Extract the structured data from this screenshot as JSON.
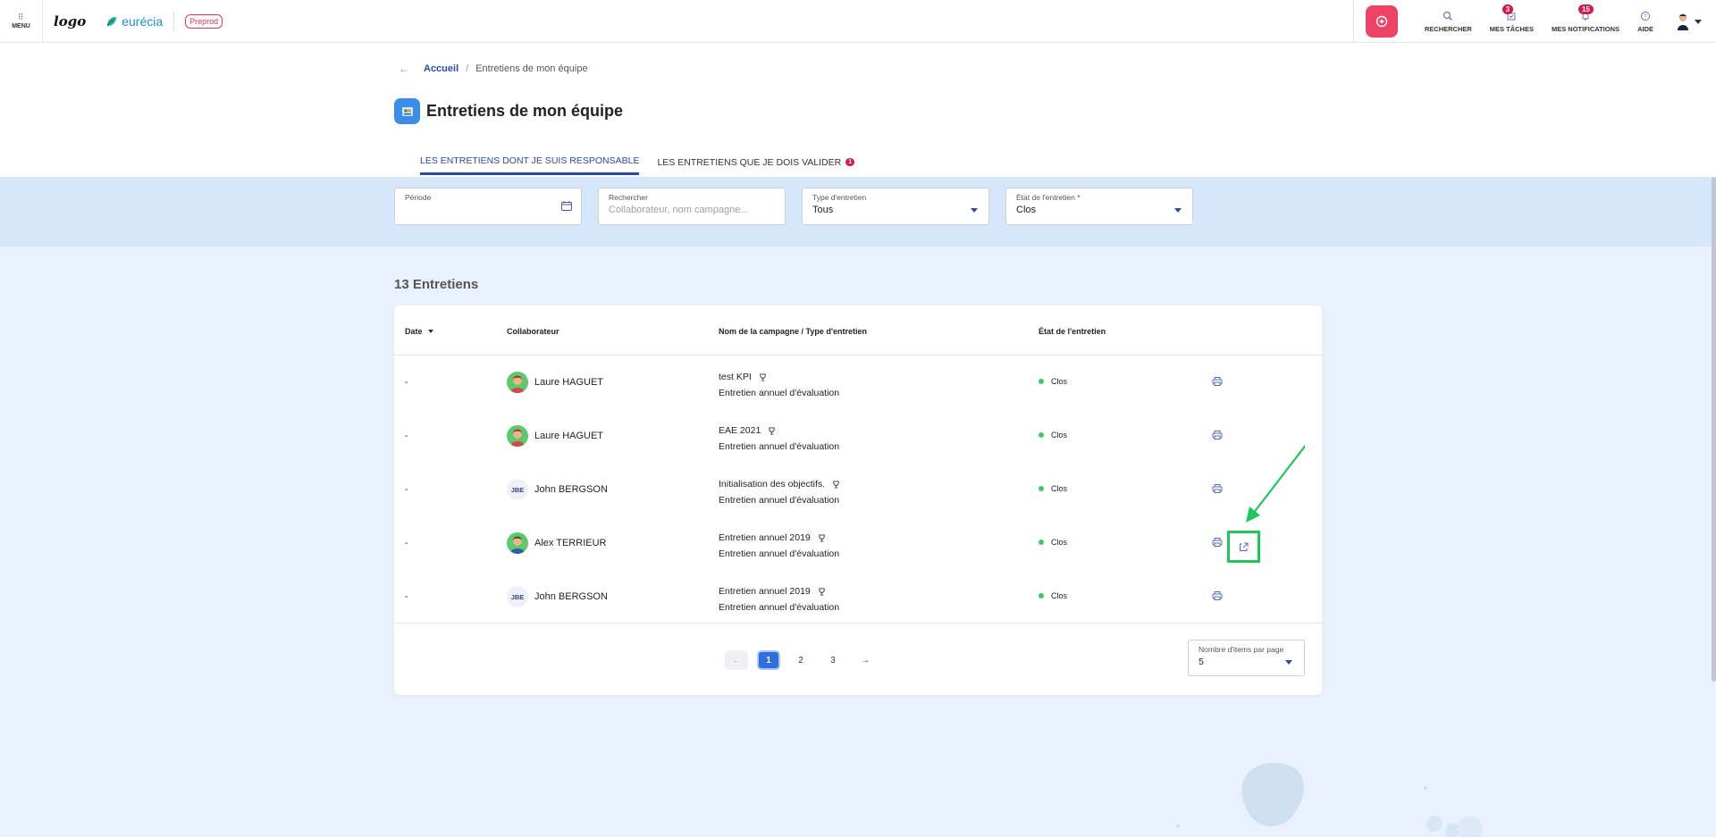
{
  "topbar": {
    "menu_label": "MENU",
    "logo_text": "logo",
    "brand_name": "eurécia",
    "env_badge": "Preprod",
    "nav": [
      {
        "label": "RECHERCHER",
        "icon": "search-icon",
        "badge": ""
      },
      {
        "label": "MES TÂCHES",
        "icon": "tasks-icon",
        "badge": "3"
      },
      {
        "label": "MES NOTIFICATIONS",
        "icon": "bell-icon",
        "badge": "15"
      },
      {
        "label": "AIDE",
        "icon": "help-icon",
        "badge": ""
      }
    ]
  },
  "breadcrumb": {
    "back": "←",
    "home": "Accueil",
    "separator": "/",
    "current": "Entretiens de mon équipe"
  },
  "page": {
    "title": "Entretiens de mon équipe"
  },
  "tabs": [
    {
      "label": "LES ENTRETIENS DONT JE SUIS RESPONSABLE",
      "active": true,
      "badge": ""
    },
    {
      "label": "LES ENTRETIENS QUE JE DOIS VALIDER",
      "active": false,
      "badge": "1"
    }
  ],
  "filters": {
    "period": {
      "label": "Période",
      "value": ""
    },
    "search": {
      "label": "Rechercher",
      "placeholder": "Collaborateur, nom campagne..."
    },
    "type": {
      "label": "Type d'entretien",
      "value": "Tous"
    },
    "state": {
      "label": "État de l'entretien",
      "required_mark": "*",
      "value": "Clos"
    }
  },
  "list": {
    "count_title": "13 Entretiens",
    "headers": {
      "date": "Date",
      "collaborator": "Collaborateur",
      "campaign": "Nom de la campagne / Type d'entretien",
      "state": "État de l'entretien"
    },
    "rows": [
      {
        "date": "-",
        "collaborator": "Laure HAGUET",
        "avatar": "photo",
        "initials": "",
        "campaign": "test KPI",
        "type": "Entretien annuel d'évaluation",
        "state": "Clos",
        "external_link": false
      },
      {
        "date": "-",
        "collaborator": "Laure HAGUET",
        "avatar": "photo",
        "initials": "",
        "campaign": "EAE 2021",
        "type": "Entretien annuel d'évaluation",
        "state": "Clos",
        "external_link": false
      },
      {
        "date": "-",
        "collaborator": "John BERGSON",
        "avatar": "initials",
        "initials": "JBE",
        "campaign": "Initialisation des objectifs.",
        "type": "Entretien annuel d'évaluation",
        "state": "Clos",
        "external_link": false
      },
      {
        "date": "-",
        "collaborator": "Alex TERRIEUR",
        "avatar": "photo",
        "initials": "",
        "campaign": "Entretien annuel 2019",
        "type": "Entretien annuel d'évaluation",
        "state": "Clos",
        "external_link": true
      },
      {
        "date": "-",
        "collaborator": "John BERGSON",
        "avatar": "initials",
        "initials": "JBE",
        "campaign": "Entretien annuel 2019",
        "type": "Entretien annuel d'évaluation",
        "state": "Clos",
        "external_link": false
      }
    ]
  },
  "pagination": {
    "prev": "←",
    "pages": [
      "1",
      "2",
      "3"
    ],
    "current_page": "1",
    "next": "→",
    "per_page_label": "Nombre d'items par page",
    "per_page_value": "5"
  },
  "colors": {
    "accent": "#2a4aa8",
    "brand_pink": "#ee4267",
    "status_closed": "#3cc86b",
    "annotation_green": "#1fc75a",
    "page_bg": "#e8f1fd"
  }
}
